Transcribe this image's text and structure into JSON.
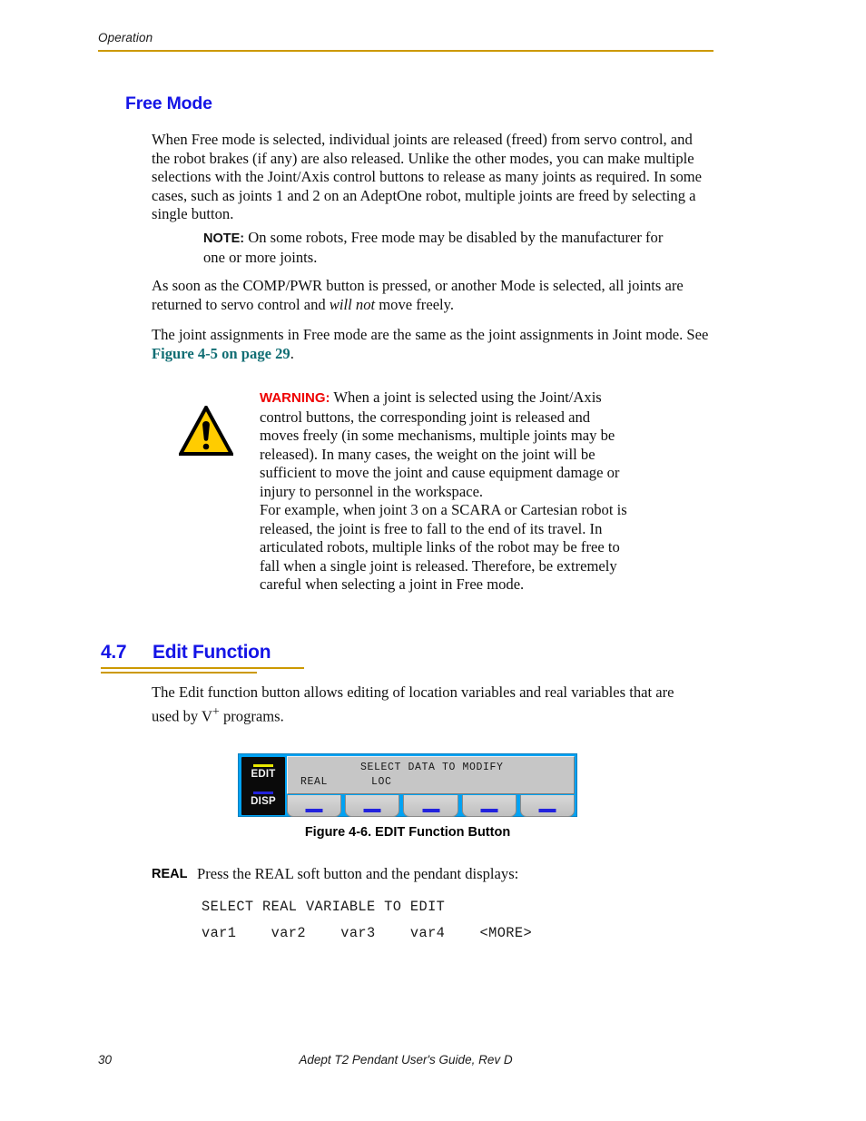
{
  "header": {
    "running_head": "Operation",
    "rule_color": "#CC9900"
  },
  "free_mode": {
    "heading": "Free Mode",
    "heading_color": "#1414E6",
    "paragraph_1": "When Free mode is selected, individual joints are released (freed) from servo control, and the robot brakes (if any) are also released. Unlike the other modes, you can make multiple selections with the Joint/Axis control buttons to release as many joints as required. In some cases, such as joints 1 and 2 on an AdeptOne robot, multiple joints are freed by selecting a single button.",
    "note_label": "NOTE:",
    "note_text": " On some robots, Free mode may be disabled by the manufacturer for one or more joints.",
    "paragraph_2_a": "As soon as the COMP/PWR button is pressed, or another Mode is selected, all joints are returned to servo control and ",
    "paragraph_2_italic": "will not",
    "paragraph_2_b": " move freely.",
    "paragraph_3_a": "The joint assignments in Free mode are the same as the joint assignments in Joint mode. See ",
    "paragraph_3_xref": "Figure 4-5 on page 29",
    "paragraph_3_b": ".",
    "xref_color": "#116E74"
  },
  "warning": {
    "icon": "warning-triangle-icon",
    "icon_fill": "#FFCC00",
    "label": "WARNING:",
    "label_color": "#EE0000",
    "text": " When a joint is selected using the Joint/Axis control buttons, the corresponding joint is released and moves freely (in some mechanisms, multiple joints may be released). In many cases, the weight on the joint will be sufficient to move the joint and cause equipment damage or injury to personnel in the workspace.",
    "text_2": "For example, when joint 3 on a SCARA or Cartesian robot is released, the joint is free to fall to the end of its travel. In articulated robots, multiple links of the robot may be free to fall when a single joint is released. Therefore, be extremely careful when selecting a joint in Free mode."
  },
  "section": {
    "number": "4.7",
    "title": "Edit Function",
    "title_color": "#1414E6",
    "intro_a": "The Edit function button allows editing of location variables and real variables that are used by V",
    "intro_sup": "+",
    "intro_b": " programs."
  },
  "figure": {
    "caption": "Figure 4-6. EDIT Function Button",
    "background_color": "#00A2F3",
    "panel_color": "#0a0a0a",
    "lcd_color": "#c6c6c6",
    "mode_button": {
      "upper_label": "EDIT",
      "upper_led_color": "#E8E800",
      "lower_label": "DISP",
      "lower_led_color": "#2222DD"
    },
    "lcd": {
      "title_line": "SELECT DATA TO MODIFY",
      "option_1": "REAL",
      "option_2": "LOC"
    },
    "soft_buttons": [
      {
        "dash_color": "#2222DD"
      },
      {
        "dash_color": "#2222DD"
      },
      {
        "dash_color": "#2222DD"
      },
      {
        "dash_color": "#2222DD"
      },
      {
        "dash_color": "#2222DD"
      }
    ]
  },
  "real_block": {
    "label": "REAL",
    "text": "Press the REAL soft button and the pendant displays:",
    "display_line_1": "SELECT REAL VARIABLE TO EDIT",
    "display_line_2": "var1    var2    var3    var4    <MORE>"
  },
  "footer": {
    "page_number": "30",
    "document_title": "Adept T2 Pendant User's Guide, Rev D"
  }
}
